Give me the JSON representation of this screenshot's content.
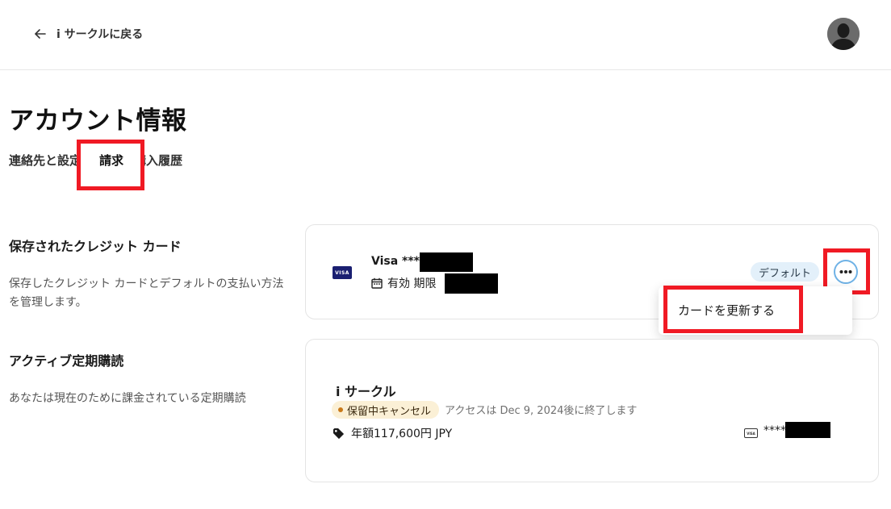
{
  "header": {
    "back_label": "i サークルに戻る"
  },
  "page": {
    "title": "アカウント情報"
  },
  "tabs": [
    {
      "label": "連絡先と設定"
    },
    {
      "label": "請求"
    },
    {
      "label": "購入履歴"
    }
  ],
  "saved_cards": {
    "title": "保存されたクレジット カード",
    "description": "保存したクレジット カードとデフォルトの支払い方法を管理します。",
    "card": {
      "brand_logo": "VISA",
      "name": "Visa ****",
      "expiry_label": "有効 期限",
      "default_badge": "デフォルト"
    },
    "menu": {
      "update_card": "カードを更新する"
    }
  },
  "subscriptions": {
    "title": "アクティブ定期購読",
    "description": "あなたは現在のために課金されている定期購読",
    "item": {
      "name": "i サークル",
      "status": "保留中キャンセル",
      "access_note": "アクセスは Dec 9, 2024後に終了します",
      "price": "年額117,600円 JPY",
      "card_mask": "****",
      "brand_logo": "VISA"
    }
  },
  "colors": {
    "highlight": "#f01a24",
    "default_badge_bg": "#e3f0fa",
    "status_badge_bg": "#fbf0d6",
    "more_button_ring": "#6fb2e6"
  }
}
